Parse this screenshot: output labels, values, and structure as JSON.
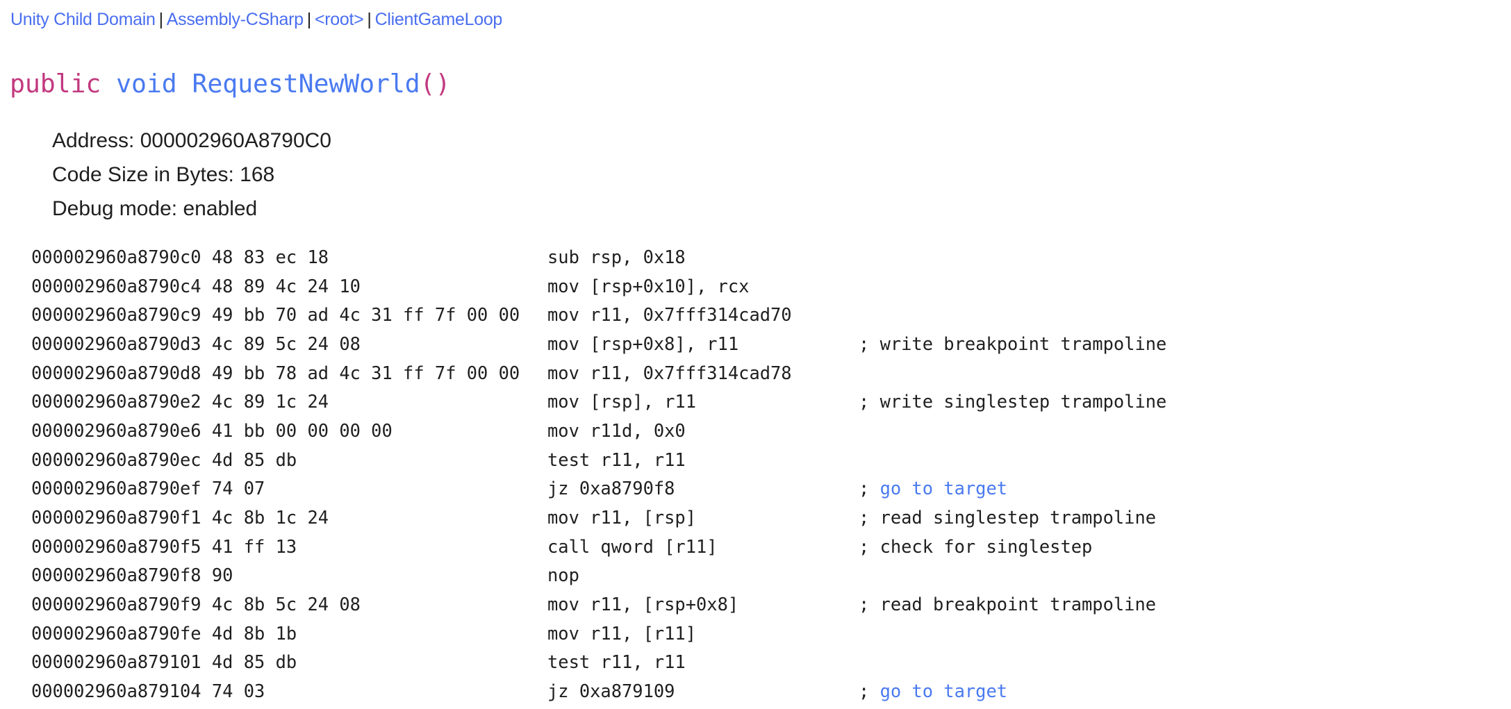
{
  "breadcrumb": [
    {
      "label": "Unity Child Domain"
    },
    {
      "label": "Assembly-CSharp"
    },
    {
      "label": "<root>"
    },
    {
      "label": "ClientGameLoop"
    }
  ],
  "breadcrumb_separator": "|",
  "signature": {
    "modifier": "public",
    "return_type": "void",
    "name": "RequestNewWorld",
    "params": "()"
  },
  "meta": {
    "address": "Address: 000002960A8790C0",
    "code_size": "Code Size in Bytes: 168",
    "debug_mode": "Debug mode: enabled"
  },
  "colors": {
    "link": "#4a7af0",
    "keyword_modifier": "#c2397f",
    "text": "#1f1f1f"
  },
  "disassembly": [
    {
      "address": "000002960a8790c0",
      "bytes": "48 83 ec 18",
      "instruction": "sub rsp, 0x18",
      "comment": "",
      "comment_is_link": false
    },
    {
      "address": "000002960a8790c4",
      "bytes": "48 89 4c 24 10",
      "instruction": "mov [rsp+0x10], rcx",
      "comment": "",
      "comment_is_link": false
    },
    {
      "address": "000002960a8790c9",
      "bytes": "49 bb 70 ad 4c 31 ff 7f 00 00",
      "instruction": "mov r11, 0x7fff314cad70",
      "comment": "",
      "comment_is_link": false
    },
    {
      "address": "000002960a8790d3",
      "bytes": "4c 89 5c 24 08",
      "instruction": "mov [rsp+0x8], r11",
      "comment": "write breakpoint trampoline",
      "comment_is_link": false
    },
    {
      "address": "000002960a8790d8",
      "bytes": "49 bb 78 ad 4c 31 ff 7f 00 00",
      "instruction": "mov r11, 0x7fff314cad78",
      "comment": "",
      "comment_is_link": false
    },
    {
      "address": "000002960a8790e2",
      "bytes": "4c 89 1c 24",
      "instruction": "mov [rsp], r11",
      "comment": "write singlestep trampoline",
      "comment_is_link": false
    },
    {
      "address": "000002960a8790e6",
      "bytes": "41 bb 00 00 00 00",
      "instruction": "mov r11d, 0x0",
      "comment": "",
      "comment_is_link": false
    },
    {
      "address": "000002960a8790ec",
      "bytes": "4d 85 db",
      "instruction": "test r11, r11",
      "comment": "",
      "comment_is_link": false
    },
    {
      "address": "000002960a8790ef",
      "bytes": "74 07",
      "instruction": "jz 0xa8790f8",
      "comment": "go to target",
      "comment_is_link": true
    },
    {
      "address": "000002960a8790f1",
      "bytes": "4c 8b 1c 24",
      "instruction": "mov r11, [rsp]",
      "comment": "read singlestep trampoline",
      "comment_is_link": false
    },
    {
      "address": "000002960a8790f5",
      "bytes": "41 ff 13",
      "instruction": "call qword [r11]",
      "comment": "check for singlestep",
      "comment_is_link": false
    },
    {
      "address": "000002960a8790f8",
      "bytes": "90",
      "instruction": "nop",
      "comment": "",
      "comment_is_link": false
    },
    {
      "address": "000002960a8790f9",
      "bytes": "4c 8b 5c 24 08",
      "instruction": "mov r11, [rsp+0x8]",
      "comment": "read breakpoint trampoline",
      "comment_is_link": false
    },
    {
      "address": "000002960a8790fe",
      "bytes": "4d 8b 1b",
      "instruction": "mov r11, [r11]",
      "comment": "",
      "comment_is_link": false
    },
    {
      "address": "000002960a879101",
      "bytes": "4d 85 db",
      "instruction": "test r11, r11",
      "comment": "",
      "comment_is_link": false
    },
    {
      "address": "000002960a879104",
      "bytes": "74 03",
      "instruction": "jz 0xa879109",
      "comment": "go to target",
      "comment_is_link": true
    }
  ]
}
